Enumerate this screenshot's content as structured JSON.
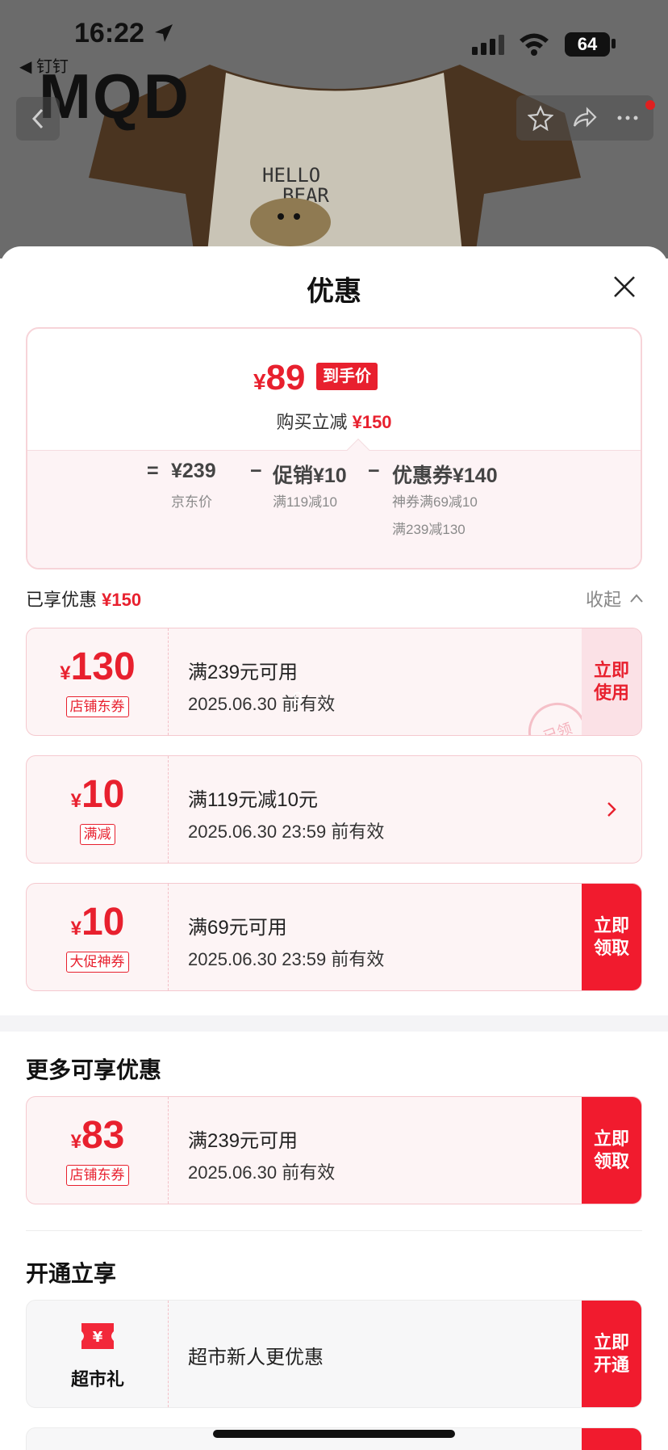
{
  "status_bar": {
    "time": "16:22",
    "back_app": "◀ 钉钉",
    "battery": "64"
  },
  "store": {
    "brand": "MQD",
    "shirt_text_1": "HELLO",
    "shirt_text_2": "BEAR"
  },
  "sheet": {
    "title": "优惠"
  },
  "summary": {
    "final_yen": "¥",
    "final_price": "89",
    "final_tag": "到手价",
    "reduce_label": "购买立减",
    "reduce_value": "¥150",
    "eq": "=",
    "jd_price": "¥239",
    "jd_label": "京东价",
    "minus1": "−",
    "promo": "促销¥10",
    "promo_sub": "满119减10",
    "minus2": "−",
    "coupon": "优惠券¥140",
    "coupon_sub1": "神券满69减10",
    "coupon_sub2": "满239减130"
  },
  "enjoyed": {
    "label": "已享优惠",
    "value": "¥150",
    "collapse": "收起"
  },
  "coupons": [
    {
      "yen": "¥",
      "amount": "130",
      "badge": "店铺东券",
      "title": "满239元可用",
      "date": "2025.06.30 前有效",
      "action": "立即使用",
      "stamp": "已领",
      "watermark": "9"
    },
    {
      "yen": "¥",
      "amount": "10",
      "badge": "满减",
      "title": "满119元减10元",
      "date": "2025.06.30 23:59 前有效",
      "action": "›"
    },
    {
      "yen": "¥",
      "amount": "10",
      "badge": "大促神券",
      "title": "满69元可用",
      "date": "2025.06.30 23:59 前有效",
      "action": "立即领取"
    }
  ],
  "more": {
    "title": "更多可享优惠",
    "coupon": {
      "yen": "¥",
      "amount": "83",
      "badge": "店铺东券",
      "title": "满239元可用",
      "date": "2025.06.30 前有效",
      "action": "立即领取"
    }
  },
  "open": {
    "title": "开通立享",
    "card": {
      "icon": "ticket-yen-icon",
      "label": "超市礼",
      "title": "超市新人更优惠",
      "action": "立即开通"
    }
  },
  "colors": {
    "accent": "#e8202e",
    "action_red": "#f11b2e",
    "pink_bg": "#fdf4f5"
  }
}
